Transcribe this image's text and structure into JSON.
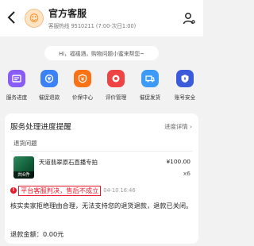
{
  "header": {
    "title": "官方客服",
    "hotline": "客服热线 9510211 (7:00-次日1:00)"
  },
  "greeting": "Hi，福禧酒，购物问题小蜜来帮您~",
  "quick_actions": [
    {
      "label": "服务进度",
      "icon": "service-progress-icon",
      "color": "#8a5cf6"
    },
    {
      "label": "催促退款",
      "icon": "refund-urge-icon",
      "color": "#3b82f6"
    },
    {
      "label": "价保中心",
      "icon": "price-protect-icon",
      "color": "#f97316"
    },
    {
      "label": "评价管理",
      "icon": "review-manage-icon",
      "color": "#ef4444"
    },
    {
      "label": "催促发货",
      "icon": "ship-urge-icon",
      "color": "#3b9bf6"
    },
    {
      "label": "账号安全",
      "icon": "account-security-icon",
      "color": "#3b5bdb"
    }
  ],
  "card": {
    "title": "服务处理进度提醒",
    "link": "进度详情",
    "issue_label": "退货问题",
    "product": {
      "name": "天道翡翠原石直播专拍",
      "price": "¥100.00",
      "qty": "x6",
      "badge": "共6件"
    },
    "status": "平台客服判决，售后不成立",
    "status_time": "04-10 16:46",
    "description": "核实卖家拒绝理由合理，无法支持您的退货退款，退款已关闭。",
    "refund": "退款金额：0.00元"
  },
  "colors": {
    "accent_red": "#e8172a",
    "background": "#f2f2f2"
  }
}
